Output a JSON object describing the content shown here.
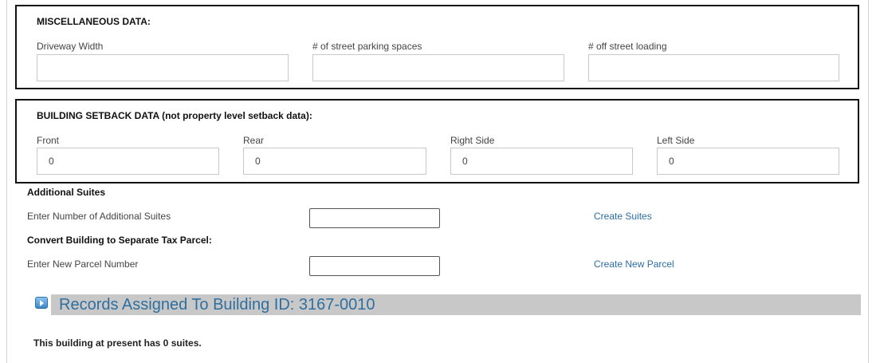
{
  "misc": {
    "title": "MISCELLANEOUS DATA:",
    "fields": [
      {
        "label": "Driveway Width",
        "value": ""
      },
      {
        "label": "# of street parking spaces",
        "value": ""
      },
      {
        "label": "# off street loading",
        "value": ""
      }
    ]
  },
  "setback": {
    "title": "BUILDING SETBACK DATA (not property level setback data):",
    "fields": [
      {
        "label": "Front",
        "value": "0"
      },
      {
        "label": "Rear",
        "value": "0"
      },
      {
        "label": "Right Side",
        "value": "0"
      },
      {
        "label": "Left Side",
        "value": "0"
      }
    ]
  },
  "additional_suites": {
    "heading": "Additional Suites",
    "label": "Enter Number of Additional Suites",
    "value": "",
    "link": "Create Suites"
  },
  "convert_parcel": {
    "heading": "Convert Building to Separate Tax Parcel:",
    "label": "Enter New Parcel Number",
    "value": "",
    "link": "Create New Parcel"
  },
  "records": {
    "title": "Records Assigned To Building ID: 3167-0010",
    "icon": "expand-icon",
    "icon_color": "#3b86c9"
  },
  "suites_note": "This building at present has 0 suites."
}
